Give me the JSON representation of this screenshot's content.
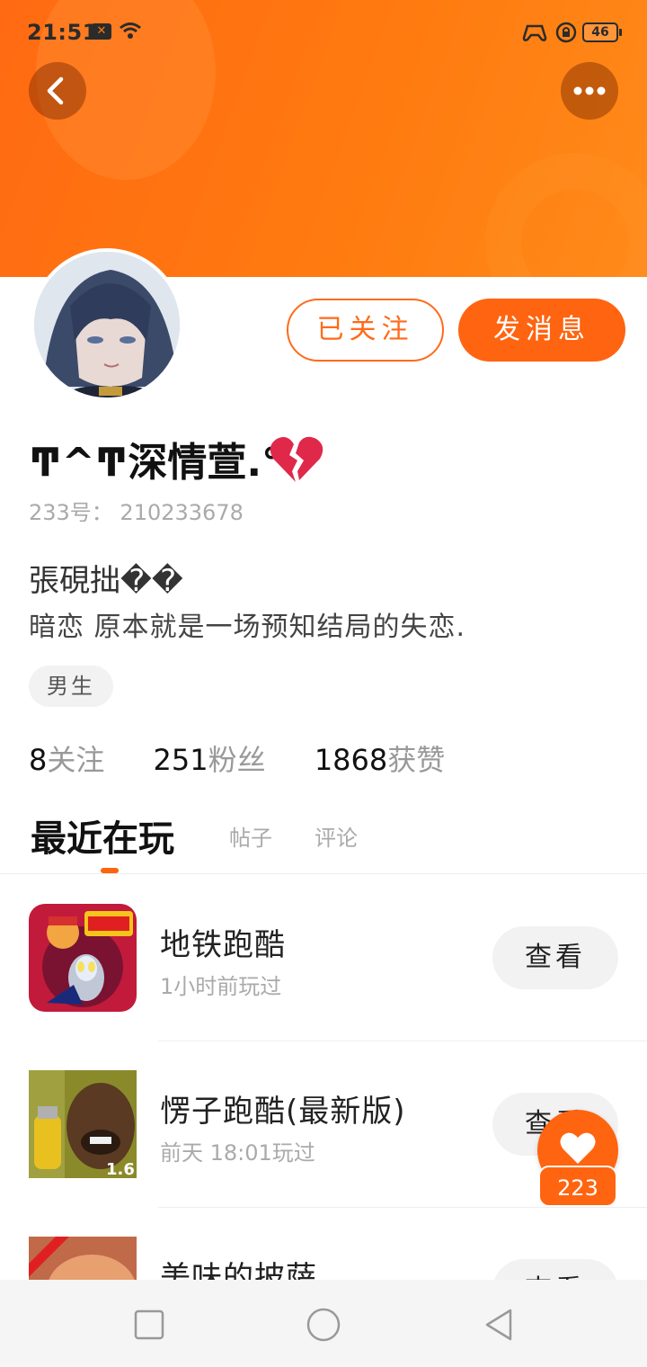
{
  "status_bar": {
    "time": "21:51",
    "battery": "46"
  },
  "profile": {
    "nickname": "ͳ^ͳ深情萱.°",
    "uid": "233号： 210233678",
    "signature_name": "張硯拙��",
    "bio": "暗恋 原本就是一场预知结局的失恋.",
    "gender": "男生",
    "follow_label": "已关注",
    "message_label": "发消息"
  },
  "stats": {
    "following": "8",
    "following_label": "关注",
    "fans": "251",
    "fans_label": "粉丝",
    "likes": "1868",
    "likes_label": "获赞"
  },
  "tabs": {
    "active": "最近在玩",
    "posts": "帖子",
    "comments": "评论"
  },
  "games": [
    {
      "title": "地铁跑酷",
      "subtitle": "1小时前玩过",
      "button": "查看"
    },
    {
      "title": "愣子跑酷(最新版)",
      "subtitle": "前天 18:01玩过",
      "button": "查看"
    },
    {
      "title": "美味的披萨",
      "subtitle": "",
      "button": "查看"
    }
  ],
  "like_fab": {
    "count": "223"
  },
  "colors": {
    "accent": "#ff6410",
    "banner": "#ff7a10"
  }
}
